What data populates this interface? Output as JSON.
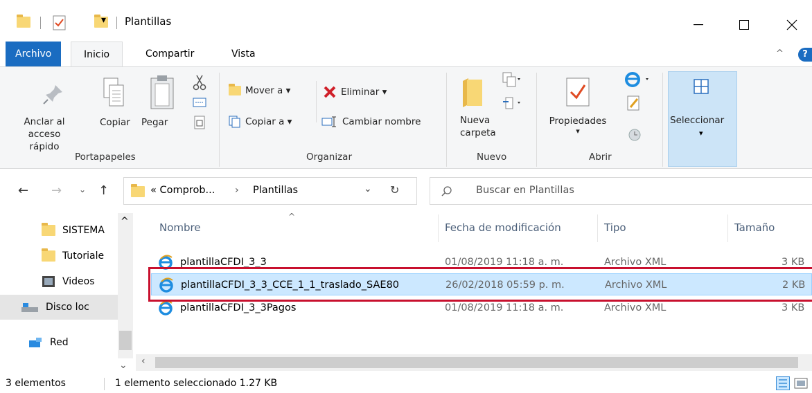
{
  "titlebar": {
    "title": "Plantillas",
    "minimize": "—",
    "maximize": "☐",
    "close": "✕"
  },
  "tabs": [
    "Archivo",
    "Inicio",
    "Compartir",
    "Vista"
  ],
  "help": "?",
  "ribbon": {
    "portapapeles": {
      "anclar": "Anclar al",
      "anclar2": "acceso rápido",
      "copiar": "Copiar",
      "pegar": "Pegar",
      "label": "Portapapeles"
    },
    "organizar": {
      "mover": "Mover a ▾",
      "copiar_a": "Copiar a ▾",
      "eliminar": "Eliminar ▾",
      "cambiar": "Cambiar nombre",
      "label": "Organizar"
    },
    "nuevo": {
      "nueva": "Nueva",
      "carpeta": "carpeta",
      "label": "Nuevo"
    },
    "abrir": {
      "propiedades": "Propiedades",
      "label": "Abrir"
    },
    "seleccionar": {
      "label": "Seleccionar"
    }
  },
  "address": {
    "path1": "« Comprob...",
    "sep": "›",
    "path2": "Plantillas",
    "search_placeholder": "Buscar en Plantillas"
  },
  "nav": [
    {
      "label": "SISTEMA"
    },
    {
      "label": "Tutoriale"
    },
    {
      "label": "Videos"
    },
    {
      "label": "Disco loc"
    },
    {
      "label": "Red"
    }
  ],
  "columns": {
    "name": "Nombre",
    "date": "Fecha de modificación",
    "type": "Tipo",
    "size": "Tamaño"
  },
  "files": [
    {
      "name": "plantillaCFDI_3_3",
      "date": "01/08/2019 11:18 a. m.",
      "type": "Archivo XML",
      "size": "3 KB"
    },
    {
      "name": "plantillaCFDI_3_3_CCE_1_1_traslado_SAE80",
      "date": "26/02/2018 05:59 p. m.",
      "type": "Archivo XML",
      "size": "2 KB"
    },
    {
      "name": "plantillaCFDI_3_3Pagos",
      "date": "01/08/2019 11:18 a. m.",
      "type": "Archivo XML",
      "size": "3 KB"
    }
  ],
  "status": {
    "count": "3 elementos",
    "selected": "1 elemento seleccionado  1.27 KB"
  },
  "colors": {
    "accent": "#1a6cc1",
    "selection": "#cce8ff",
    "highlight_box": "#c8102e"
  }
}
